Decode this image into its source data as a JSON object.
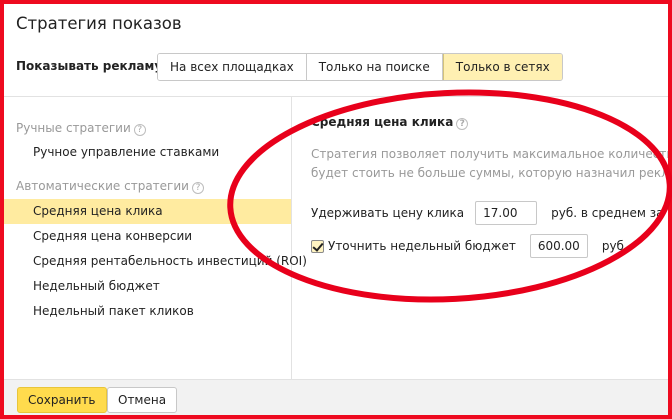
{
  "dialog": {
    "title": "Стратегия показов"
  },
  "show_ads": {
    "label": "Показывать рекламу:",
    "options": [
      "На всех площадках",
      "Только на поиске",
      "Только в сетях"
    ],
    "selected": "Только в сетях"
  },
  "sidebar": {
    "manual_group": "Ручные стратегии",
    "manual_items": [
      "Ручное управление ставками"
    ],
    "auto_group": "Автоматические стратегии",
    "auto_items": [
      "Средняя цена клика",
      "Средняя цена конверсии",
      "Средняя рентабельность инвестиций (ROI)",
      "Недельный бюджет",
      "Недельный пакет кликов"
    ],
    "active_item": "Средняя цена клика"
  },
  "pane": {
    "title": "Средняя цена клика",
    "description_lines": [
      "Стратегия позволяет получить максимальное количество кликов з",
      "будет стоить не больше суммы, которую назначил рекламодател"
    ],
    "hold_label": "Удерживать цену клика",
    "hold_value": "17.00",
    "hold_unit": "руб. в среднем за неделю",
    "budget_label": "Уточнить недельный бюджет",
    "budget_checked": true,
    "budget_value": "600.00",
    "budget_unit": "руб."
  },
  "help_glyph": "?",
  "footer": {
    "save_label": "Сохранить",
    "cancel_label": "Отмена"
  },
  "colors": {
    "frame": "#ee0a1f",
    "annotation": "#e8001b",
    "accent": "#ffdb4d",
    "active_row": "#ffeba0"
  }
}
